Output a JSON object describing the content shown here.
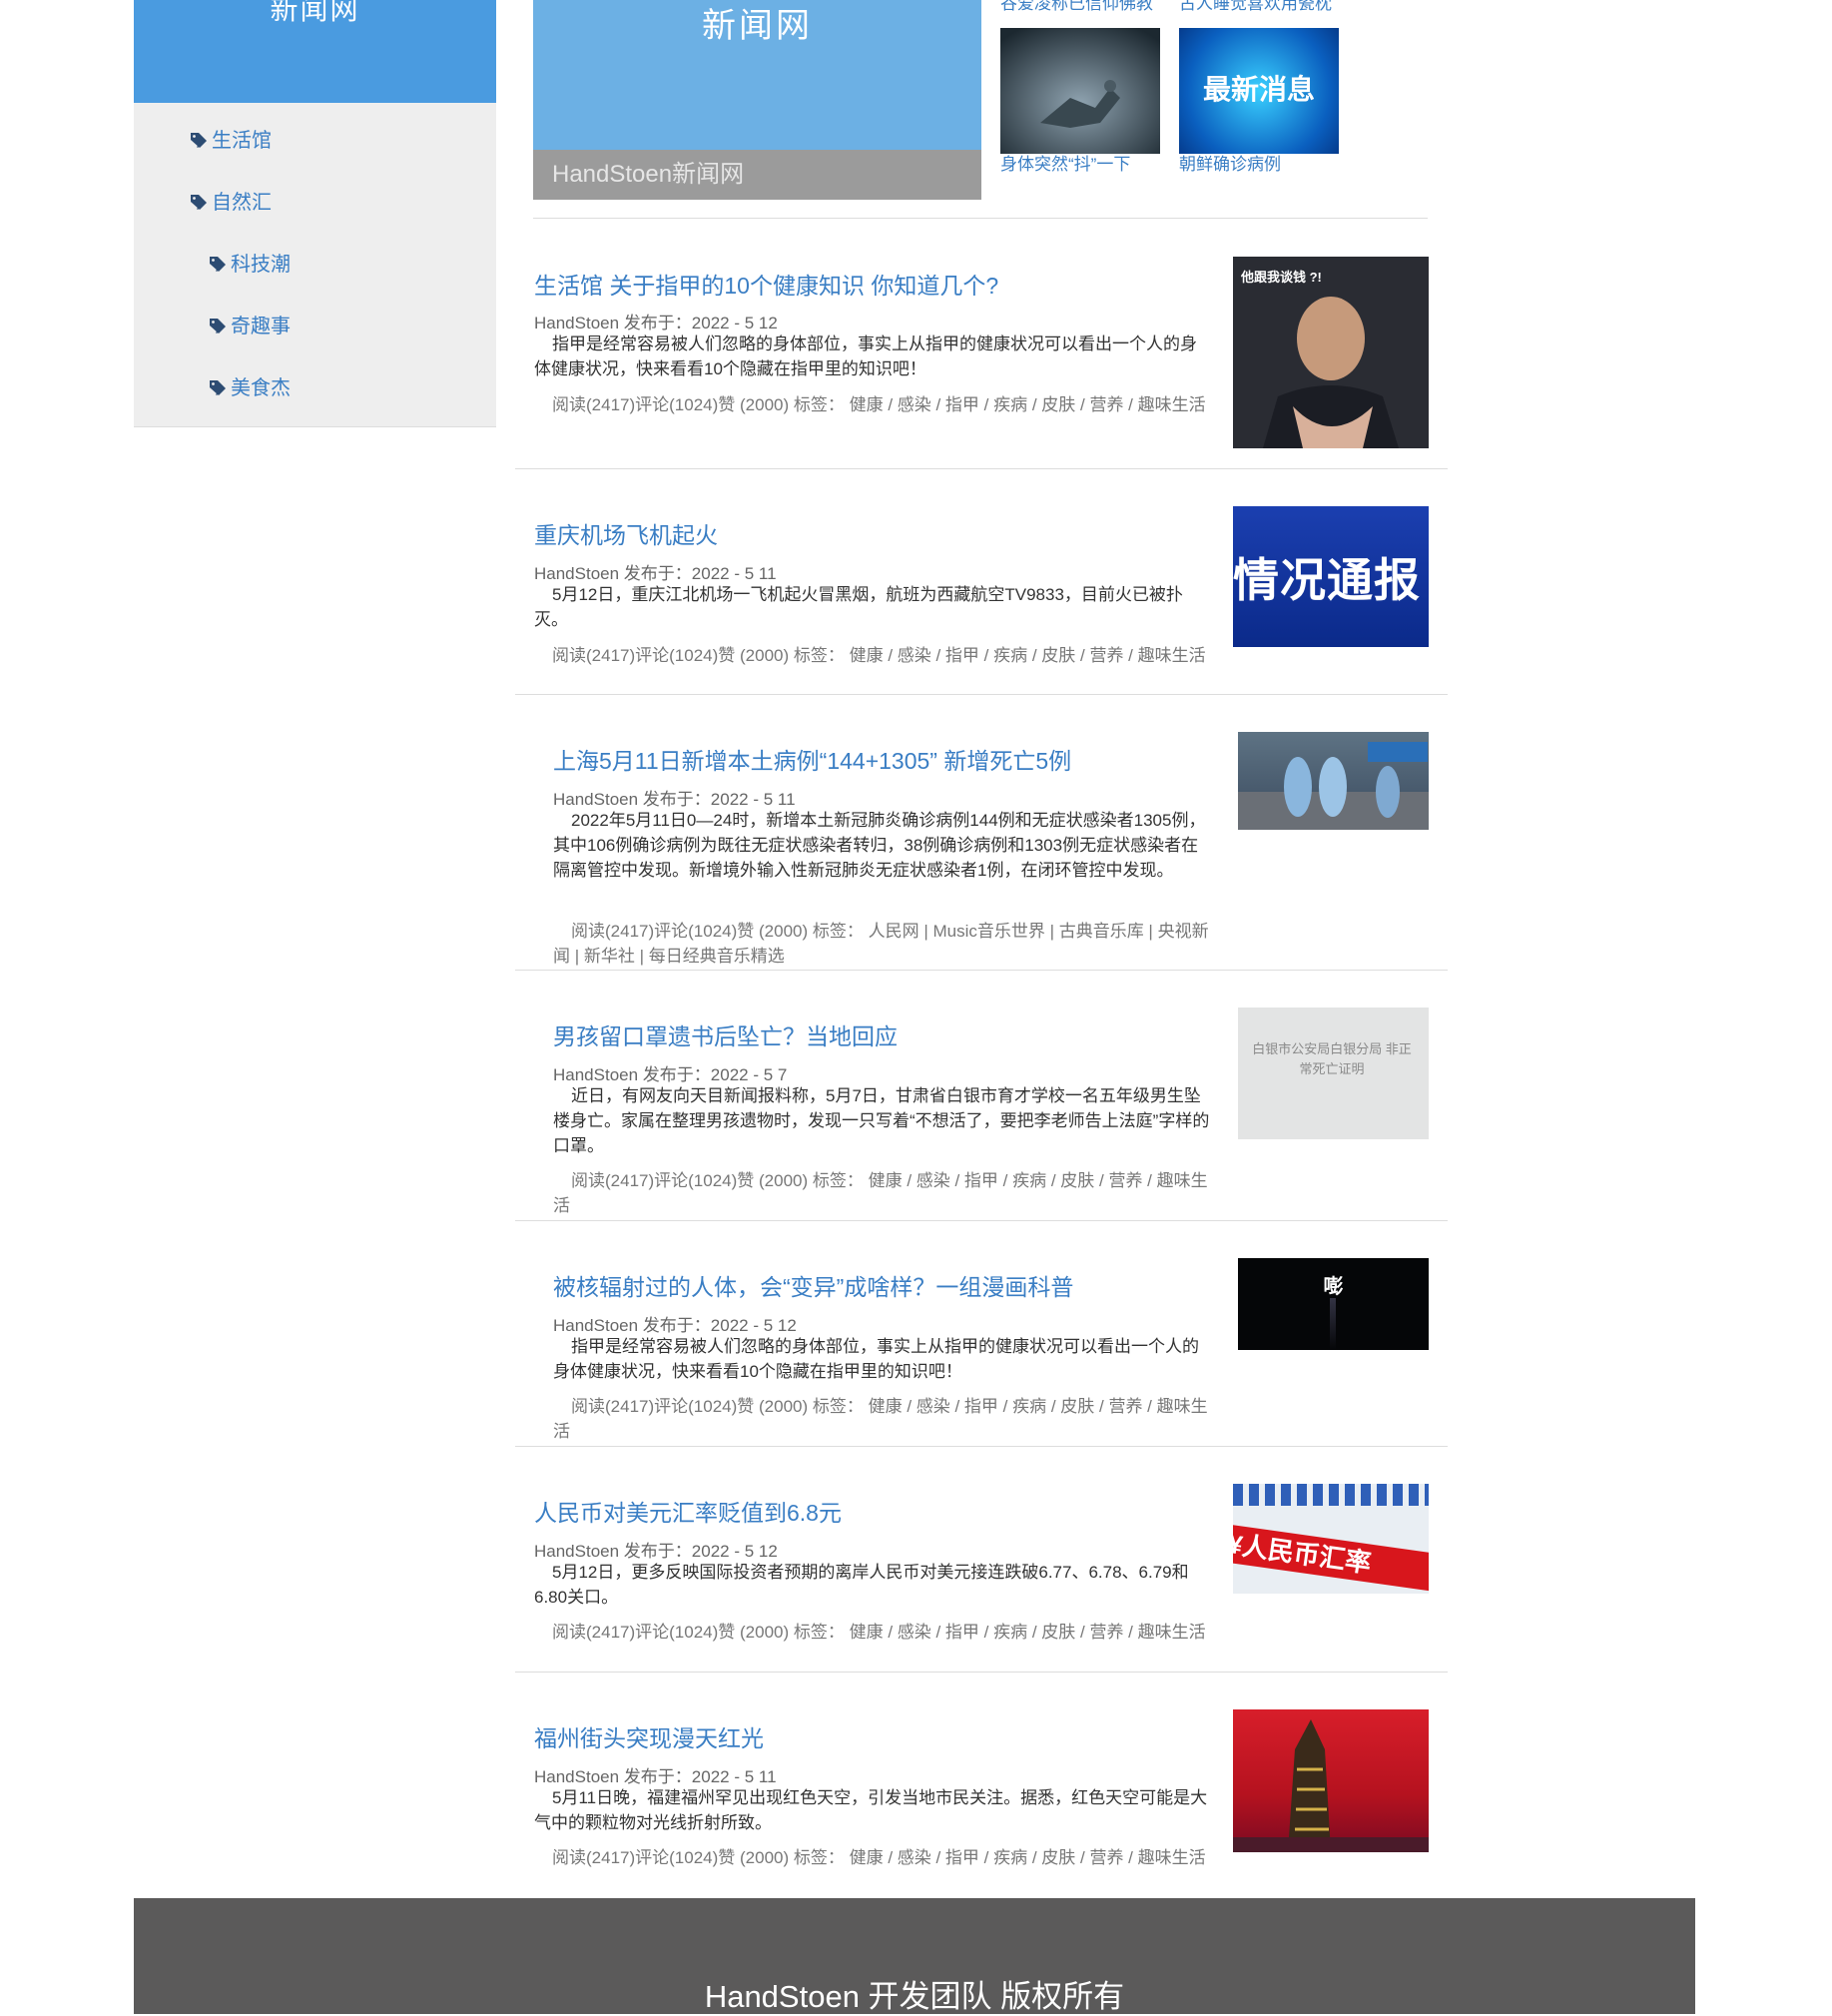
{
  "sidebar": {
    "header_title": "新闻网",
    "items": [
      {
        "label": "生活馆"
      },
      {
        "label": "自然汇"
      },
      {
        "label": "科技潮"
      },
      {
        "label": "奇趣事"
      },
      {
        "label": "美食杰"
      }
    ]
  },
  "banner": {
    "title": "新闻网",
    "caption": "HandStoen新闻网"
  },
  "featured": [
    {
      "top_label": "谷爱凌称已信仰佛教",
      "bottom_label": "身体突然“抖”一下"
    },
    {
      "top_label": "古人睡觉喜欢用瓷枕",
      "bottom_label": "朝鲜确诊病例",
      "image_text": "最新消息"
    }
  ],
  "articles": [
    {
      "title": "生活馆 关于指甲的10个健康知识 你知道几个?",
      "meta": "HandStoen 发布于：2022 - 5 12",
      "summary": "指甲是经常容易被人们忽略的身体部位，事实上从指甲的健康状况可以看出一个人的身体健康状况，快来看看10个隐藏在指甲里的知识吧！",
      "stats": "阅读(2417)评论(1024)赞 (2000) 标签： 健康 / 感染 / 指甲 / 疾病 / 皮肤 / 营养 / 趣味生活",
      "image_text": "他跟我谈钱 ?!"
    },
    {
      "title": "重庆机场飞机起火",
      "meta": "HandStoen 发布于：2022 - 5 11",
      "summary": "5月12日，重庆江北机场一飞机起火冒黑烟，航班为西藏航空TV9833，目前火已被扑灭。",
      "stats": "阅读(2417)评论(1024)赞 (2000) 标签： 健康 / 感染 / 指甲 / 疾病 / 皮肤 / 营养 / 趣味生活",
      "image_text": "情况通报"
    },
    {
      "title": "上海5月11日新增本土病例“144+1305” 新增死亡5例",
      "meta": "HandStoen 发布于：2022 - 5 11",
      "summary": "2022年5月11日0—24时，新增本土新冠肺炎确诊病例144例和无症状感染者1305例，其中106例确诊病例为既往无症状感染者转归，38例确诊病例和1303例无症状感染者在隔离管控中发现。新增境外输入性新冠肺炎无症状感染者1例，在闭环管控中发现。",
      "stats": "阅读(2417)评论(1024)赞 (2000) 标签： 人民网 | Music音乐世界 | 古典音乐库 | 央视新闻 | 新华社 | 每日经典音乐精选"
    },
    {
      "title": "男孩留口罩遗书后坠亡？当地回应",
      "meta": "HandStoen 发布于：2022 - 5 7",
      "summary": "近日，有网友向天目新闻报料称，5月7日，甘肃省白银市育才学校一名五年级男生坠楼身亡。家属在整理男孩遗物时，发现一只写着“不想活了，要把李老师告上法庭”字样的口罩。",
      "stats": "阅读(2417)评论(1024)赞 (2000) 标签： 健康 / 感染 / 指甲 / 疾病 / 皮肤 / 营养 / 趣味生活",
      "image_text": "白银市公安局白银分局 非正常死亡证明"
    },
    {
      "title": "被核辐射过的人体，会“变异”成啥样？一组漫画科普",
      "meta": "HandStoen 发布于：2022 - 5 12",
      "summary": "指甲是经常容易被人们忽略的身体部位，事实上从指甲的健康状况可以看出一个人的身体健康状况，快来看看10个隐藏在指甲里的知识吧！",
      "stats": "阅读(2417)评论(1024)赞 (2000) 标签： 健康 / 感染 / 指甲 / 疾病 / 皮肤 / 营养 / 趣味生活",
      "image_text": "嘭"
    },
    {
      "title": "人民币对美元汇率贬值到6.8元",
      "meta": "HandStoen 发布于：2022 - 5 12",
      "summary": "5月12日，更多反映国际投资者预期的离岸人民币对美元接连跌破6.77、6.78、6.79和6.80关口。",
      "stats": "阅读(2417)评论(1024)赞 (2000) 标签： 健康 / 感染 / 指甲 / 疾病 / 皮肤 / 营养 / 趣味生活",
      "image_text": "¥人民币汇率"
    },
    {
      "title": "福州街头突现漫天红光",
      "meta": "HandStoen 发布于：2022 - 5 11",
      "summary": "5月11日晚，福建福州罕见出现红色天空，引发当地市民关注。据悉，红色天空可能是大气中的颗粒物对光线折射所致。",
      "stats": "阅读(2417)评论(1024)赞 (2000) 标签： 健康 / 感染 / 指甲 / 疾病 / 皮肤 / 营养 / 趣味生活"
    }
  ],
  "footer": {
    "text": "HandStoen 开发团队 版权所有"
  }
}
